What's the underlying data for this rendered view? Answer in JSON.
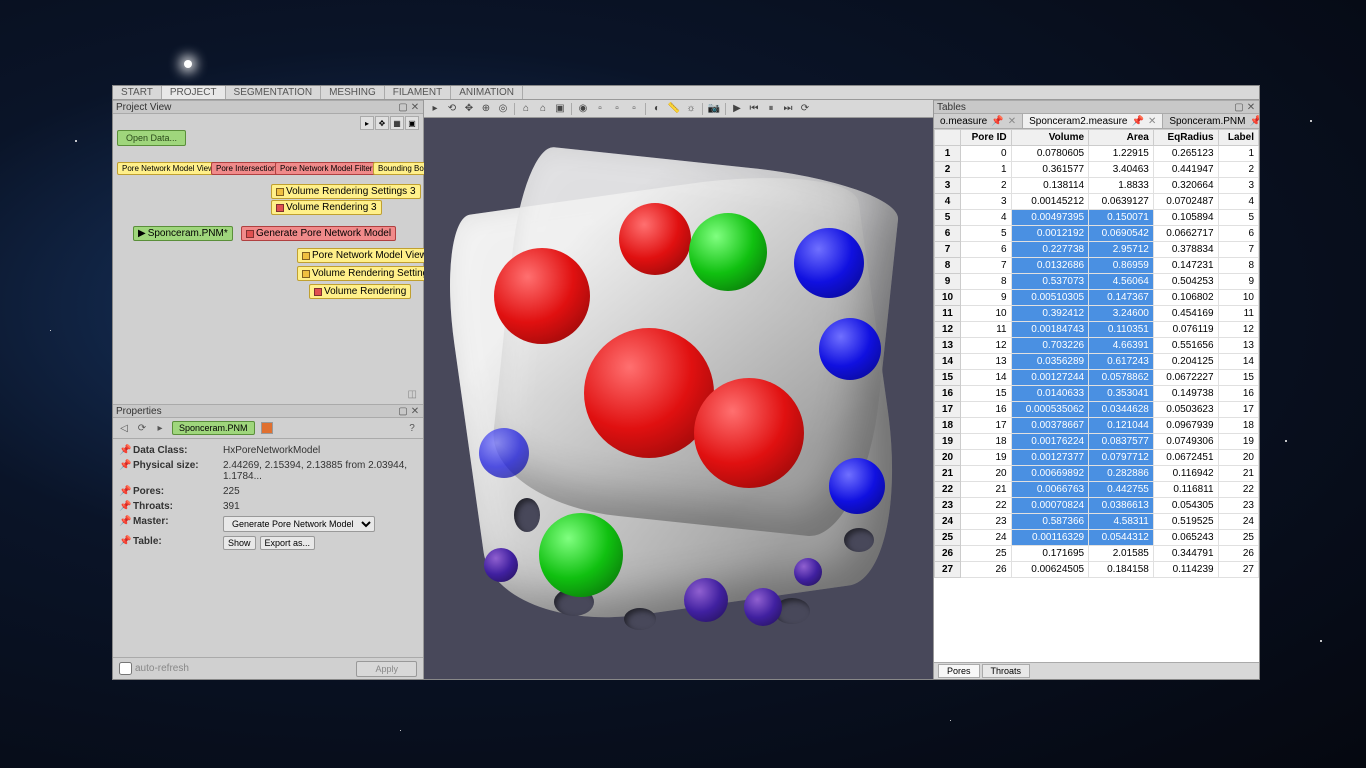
{
  "main_tabs": [
    "START",
    "PROJECT",
    "SEGMENTATION",
    "MESHING",
    "FILAMENT",
    "ANIMATION"
  ],
  "active_main_tab": 1,
  "project_view": {
    "title": "Project View",
    "open_btn": "Open Data...",
    "nodes": {
      "n1": "Pore Network Model View",
      "n2": "Pore Intersection",
      "n3": "Pore Network Model Filter",
      "n4": "Bounding Box",
      "n5": "Volume Rendering Settings 3",
      "n6": "Volume Rendering 3",
      "n7": "Sponceram.PNM*",
      "n8": "Generate Pore Network Model",
      "n9": "Pore Network Model View",
      "n10": "Volume Rendering Settings",
      "n11": "Volume Rendering"
    }
  },
  "properties": {
    "title": "Properties",
    "chip": "Sponceram.PNM",
    "rows": {
      "data_class_lbl": "Data Class:",
      "data_class_val": "HxPoreNetworkModel",
      "phys_size_lbl": "Physical size:",
      "phys_size_val": "2.44269, 2.15394, 2.13885  from 2.03944, 1.1784...",
      "pores_lbl": "Pores:",
      "pores_val": "225",
      "throats_lbl": "Throats:",
      "throats_val": "391",
      "master_lbl": "Master:",
      "master_val": "Generate Pore Network Model",
      "table_lbl": "Table:",
      "show_btn": "Show",
      "export_btn": "Export as..."
    },
    "autorefresh": "auto-refresh",
    "apply": "Apply"
  },
  "tables": {
    "title": "Tables",
    "tabs": [
      "o.measure",
      "Sponceram2.measure",
      "Sponceram.PNM"
    ],
    "active_tab": 1,
    "headers": [
      "",
      "Pore ID",
      "Volume",
      "Area",
      "EqRadius",
      "Label"
    ],
    "footer_tabs": [
      "Pores",
      "Throats"
    ],
    "active_footer": 0,
    "rows": [
      {
        "i": 1,
        "pid": 0,
        "vol": "0.0780605",
        "area": "1.22915",
        "eq": "0.265123",
        "lab": 1,
        "sel": false
      },
      {
        "i": 2,
        "pid": 1,
        "vol": "0.361577",
        "area": "3.40463",
        "eq": "0.441947",
        "lab": 2,
        "sel": false
      },
      {
        "i": 3,
        "pid": 2,
        "vol": "0.138114",
        "area": "1.8833",
        "eq": "0.320664",
        "lab": 3,
        "sel": false
      },
      {
        "i": 4,
        "pid": 3,
        "vol": "0.00145212",
        "area": "0.0639127",
        "eq": "0.0702487",
        "lab": 4,
        "sel": false
      },
      {
        "i": 5,
        "pid": 4,
        "vol": "0.00497395",
        "area": "0.150071",
        "eq": "0.105894",
        "lab": 5,
        "sel": true
      },
      {
        "i": 6,
        "pid": 5,
        "vol": "0.0012192",
        "area": "0.0690542",
        "eq": "0.0662717",
        "lab": 6,
        "sel": true
      },
      {
        "i": 7,
        "pid": 6,
        "vol": "0.227738",
        "area": "2.95712",
        "eq": "0.378834",
        "lab": 7,
        "sel": true
      },
      {
        "i": 8,
        "pid": 7,
        "vol": "0.0132686",
        "area": "0.86959",
        "eq": "0.147231",
        "lab": 8,
        "sel": true
      },
      {
        "i": 9,
        "pid": 8,
        "vol": "0.537073",
        "area": "4.56064",
        "eq": "0.504253",
        "lab": 9,
        "sel": true
      },
      {
        "i": 10,
        "pid": 9,
        "vol": "0.00510305",
        "area": "0.147367",
        "eq": "0.106802",
        "lab": 10,
        "sel": true
      },
      {
        "i": 11,
        "pid": 10,
        "vol": "0.392412",
        "area": "3.24600",
        "eq": "0.454169",
        "lab": 11,
        "sel": true
      },
      {
        "i": 12,
        "pid": 11,
        "vol": "0.00184743",
        "area": "0.110351",
        "eq": "0.076119",
        "lab": 12,
        "sel": true
      },
      {
        "i": 13,
        "pid": 12,
        "vol": "0.703226",
        "area": "4.66391",
        "eq": "0.551656",
        "lab": 13,
        "sel": true
      },
      {
        "i": 14,
        "pid": 13,
        "vol": "0.0356289",
        "area": "0.617243",
        "eq": "0.204125",
        "lab": 14,
        "sel": true
      },
      {
        "i": 15,
        "pid": 14,
        "vol": "0.00127244",
        "area": "0.0578862",
        "eq": "0.0672227",
        "lab": 15,
        "sel": true
      },
      {
        "i": 16,
        "pid": 15,
        "vol": "0.0140633",
        "area": "0.353041",
        "eq": "0.149738",
        "lab": 16,
        "sel": true
      },
      {
        "i": 17,
        "pid": 16,
        "vol": "0.000535062",
        "area": "0.0344628",
        "eq": "0.0503623",
        "lab": 17,
        "sel": true
      },
      {
        "i": 18,
        "pid": 17,
        "vol": "0.00378667",
        "area": "0.121044",
        "eq": "0.0967939",
        "lab": 18,
        "sel": true
      },
      {
        "i": 19,
        "pid": 18,
        "vol": "0.00176224",
        "area": "0.0837577",
        "eq": "0.0749306",
        "lab": 19,
        "sel": true
      },
      {
        "i": 20,
        "pid": 19,
        "vol": "0.00127377",
        "area": "0.0797712",
        "eq": "0.0672451",
        "lab": 20,
        "sel": true
      },
      {
        "i": 21,
        "pid": 20,
        "vol": "0.00669892",
        "area": "0.282886",
        "eq": "0.116942",
        "lab": 21,
        "sel": true
      },
      {
        "i": 22,
        "pid": 21,
        "vol": "0.0066763",
        "area": "0.442755",
        "eq": "0.116811",
        "lab": 22,
        "sel": true
      },
      {
        "i": 23,
        "pid": 22,
        "vol": "0.00070824",
        "area": "0.0386613",
        "eq": "0.054305",
        "lab": 23,
        "sel": true
      },
      {
        "i": 24,
        "pid": 23,
        "vol": "0.587366",
        "area": "4.58311",
        "eq": "0.519525",
        "lab": 24,
        "sel": true
      },
      {
        "i": 25,
        "pid": 24,
        "vol": "0.00116329",
        "area": "0.0544312",
        "eq": "0.065243",
        "lab": 25,
        "sel": true
      },
      {
        "i": 26,
        "pid": 25,
        "vol": "0.171695",
        "area": "2.01585",
        "eq": "0.344791",
        "lab": 26,
        "sel": false
      },
      {
        "i": 27,
        "pid": 26,
        "vol": "0.00624505",
        "area": "0.184158",
        "eq": "0.114239",
        "lab": 27,
        "sel": false
      }
    ]
  }
}
